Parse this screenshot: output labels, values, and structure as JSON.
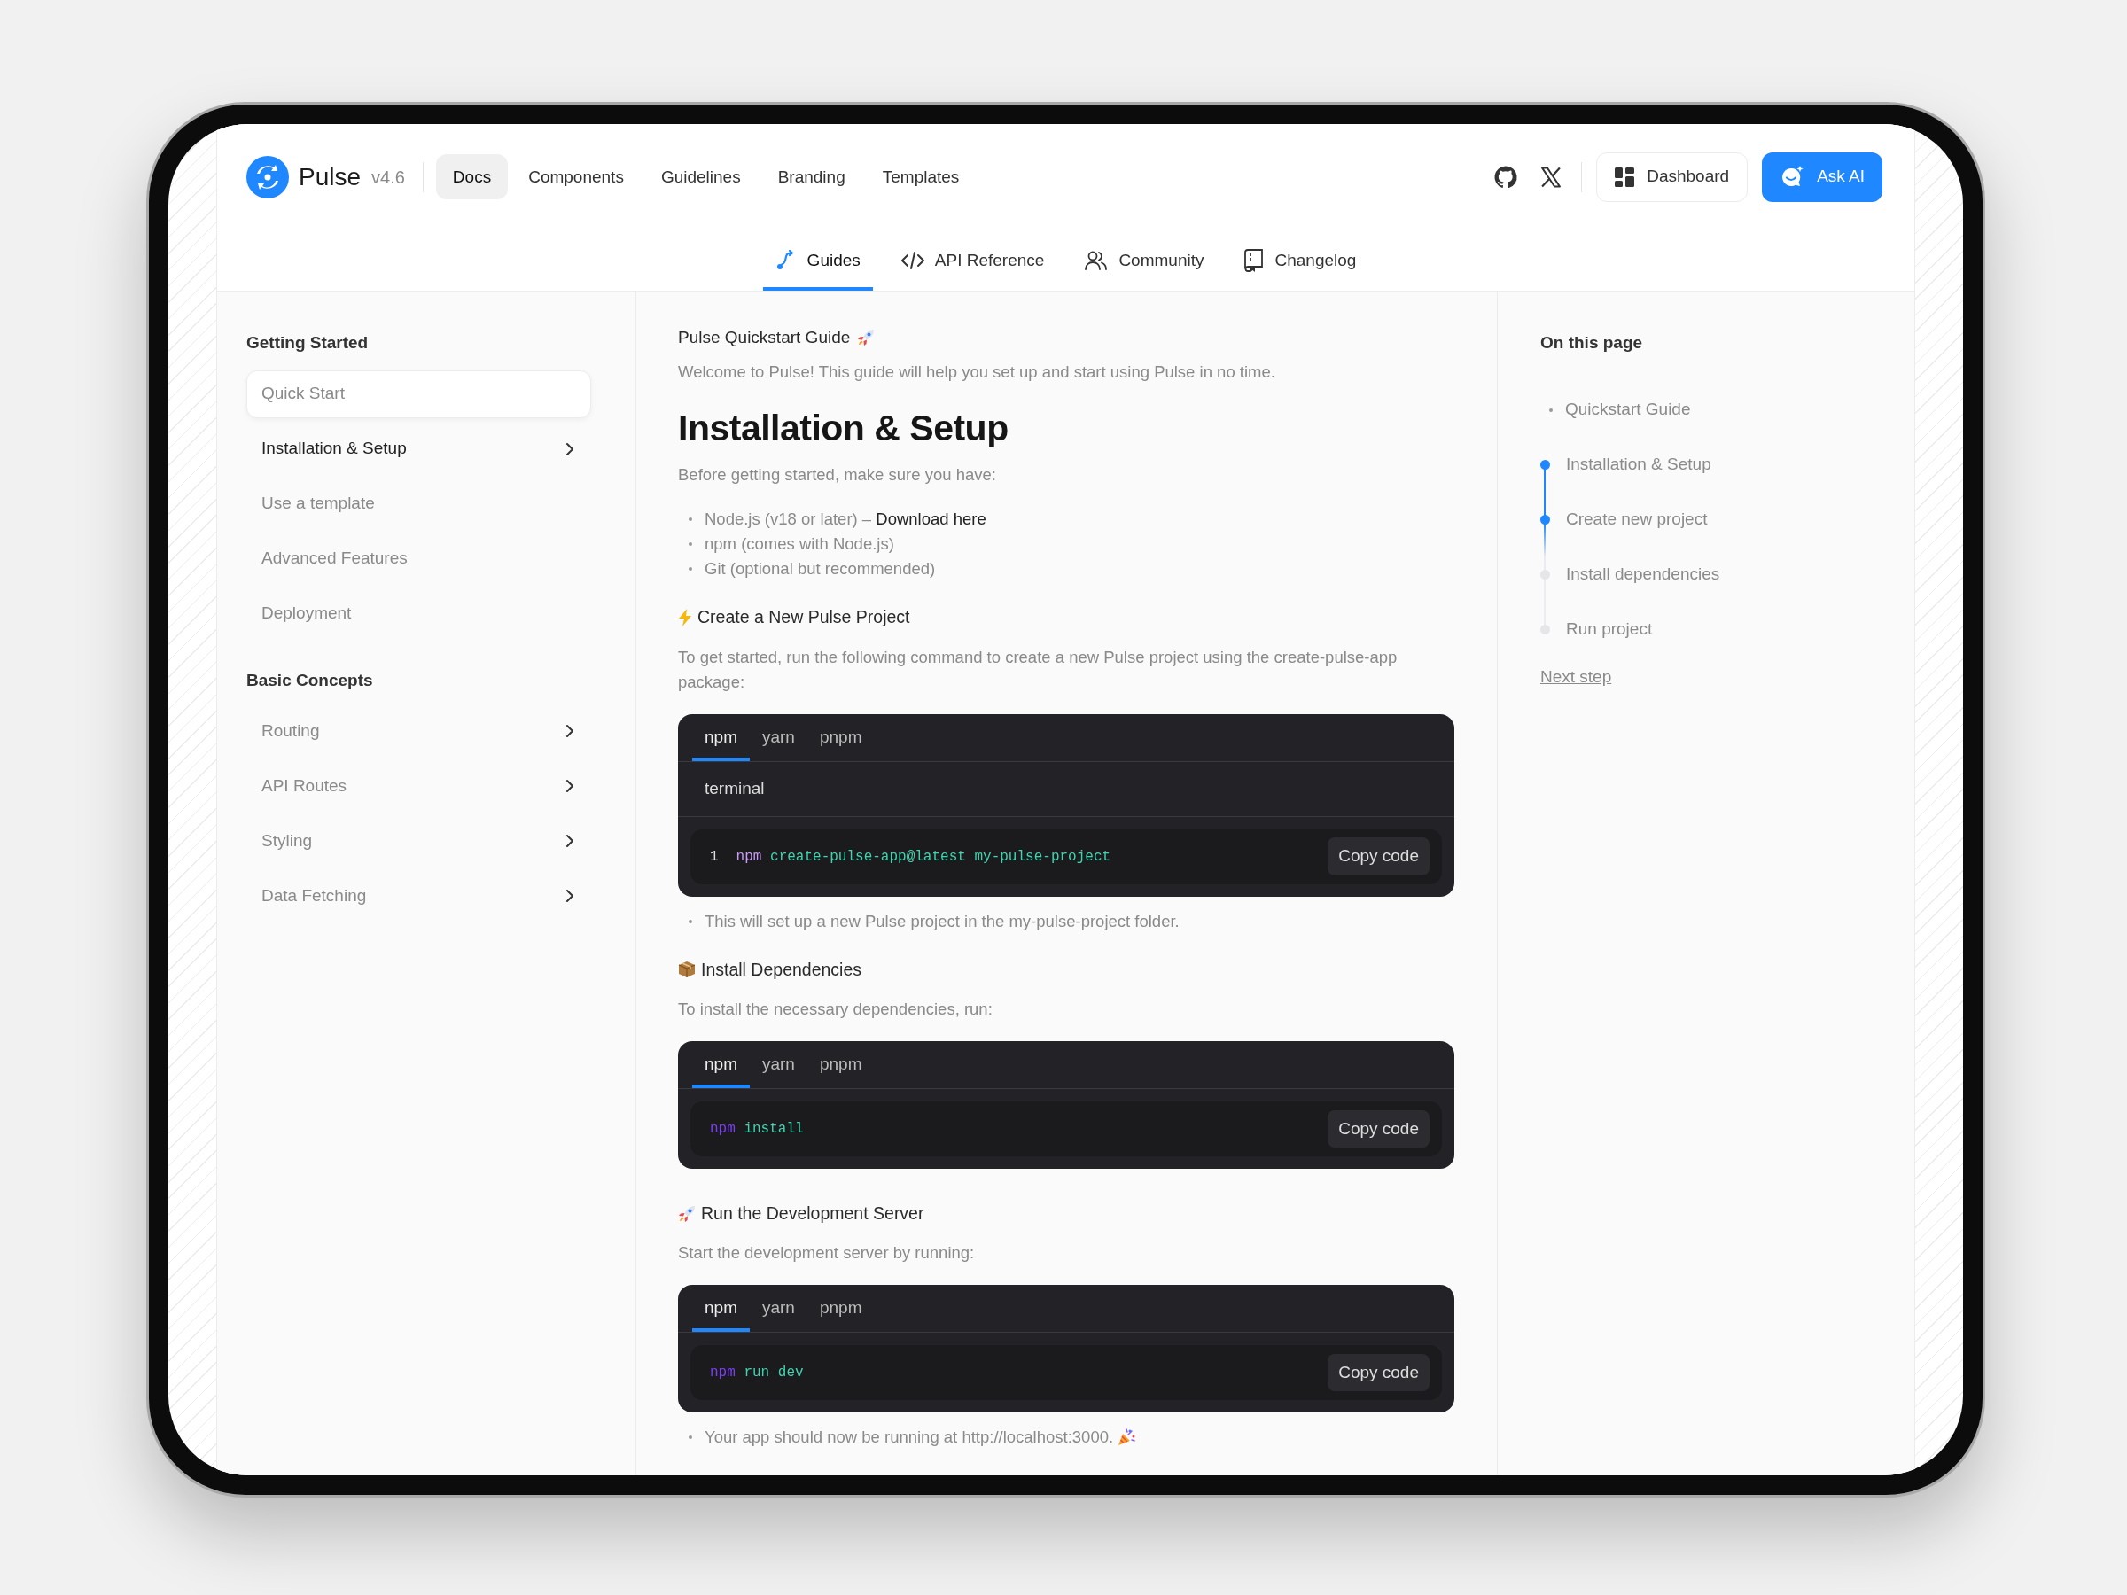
{
  "brand": {
    "name": "Pulse",
    "version": "v4.6"
  },
  "top_nav": [
    {
      "label": "Docs",
      "selected": true
    },
    {
      "label": "Components",
      "selected": false
    },
    {
      "label": "Guidelines",
      "selected": false
    },
    {
      "label": "Branding",
      "selected": false
    },
    {
      "label": "Templates",
      "selected": false
    }
  ],
  "header_buttons": [
    {
      "label": "Dashboard",
      "kind": "outline"
    },
    {
      "label": "Ask AI",
      "kind": "primary"
    }
  ],
  "sub_tabs": [
    {
      "label": "Guides",
      "selected": true
    },
    {
      "label": "API Reference",
      "selected": false
    },
    {
      "label": "Community",
      "selected": false
    },
    {
      "label": "Changelog",
      "selected": false
    }
  ],
  "sidebar": [
    {
      "title": "Getting Started",
      "items": [
        {
          "label": "Quick Start",
          "selected": true,
          "emphasized": false,
          "has_children": false
        },
        {
          "label": "Installation & Setup",
          "selected": false,
          "emphasized": true,
          "has_children": true
        },
        {
          "label": "Use a template",
          "selected": false,
          "emphasized": false,
          "has_children": false
        },
        {
          "label": "Advanced Features",
          "selected": false,
          "emphasized": false,
          "has_children": false
        },
        {
          "label": "Deployment",
          "selected": false,
          "emphasized": false,
          "has_children": false
        }
      ]
    },
    {
      "title": "Basic Concepts",
      "items": [
        {
          "label": "Routing",
          "selected": false,
          "emphasized": false,
          "has_children": true
        },
        {
          "label": "API Routes",
          "selected": false,
          "emphasized": false,
          "has_children": true
        },
        {
          "label": "Styling",
          "selected": false,
          "emphasized": false,
          "has_children": true
        },
        {
          "label": "Data Fetching",
          "selected": false,
          "emphasized": false,
          "has_children": true
        }
      ]
    }
  ],
  "content": [
    {
      "kind": "eyebrow",
      "text": "Pulse Quickstart Guide"
    },
    {
      "kind": "lead",
      "text": "Welcome to Pulse! This guide will help you set up and start using Pulse in no time."
    },
    {
      "kind": "h1",
      "text": "Installation & Setup"
    },
    {
      "kind": "para",
      "text": "Before getting started, make sure you have:"
    },
    {
      "kind": "bullets",
      "items": [
        {
          "text": "Node.js (v18 or later) – ",
          "link": "Download here"
        },
        {
          "text": "npm (comes with Node.js)"
        },
        {
          "text": "Git (optional but recommended)"
        }
      ]
    },
    {
      "kind": "h3",
      "text": "Create a New Pulse Project"
    },
    {
      "kind": "para",
      "text": "To get started, run the following command to create a new Pulse project using the create-pulse-app package:"
    },
    {
      "kind": "code",
      "tabs": [
        {
          "label": "npm",
          "selected": true
        },
        {
          "label": "yarn",
          "selected": false
        },
        {
          "label": "pnpm",
          "selected": false
        }
      ],
      "filename": "terminal",
      "lines": [
        {
          "number": "1",
          "tokens": [
            {
              "text": "npm",
              "color": "#c99cf5"
            },
            {
              "text": "create-pulse-app@latest my-pulse-project",
              "color": "#3fd4b0"
            }
          ]
        }
      ],
      "copy": "Copy code"
    },
    {
      "kind": "bullets",
      "items": [
        {
          "text": "This will set up a new Pulse project in the my-pulse-project folder."
        }
      ]
    },
    {
      "kind": "h3",
      "text": "Install Dependencies"
    },
    {
      "kind": "para",
      "text": "To install the necessary dependencies, run:"
    },
    {
      "kind": "code",
      "tabs": [
        {
          "label": "npm",
          "selected": true
        },
        {
          "label": "yarn",
          "selected": false
        },
        {
          "label": "pnpm",
          "selected": false
        }
      ],
      "lines": [
        {
          "tokens": [
            {
              "text": "npm",
              "color": "#7b3ff2"
            },
            {
              "text": "install",
              "color": "#3fd4b0"
            }
          ]
        }
      ],
      "copy": "Copy code"
    },
    {
      "kind": "h3",
      "text": "Run the Development Server"
    },
    {
      "kind": "para",
      "text": "Start the development server by running:"
    },
    {
      "kind": "code",
      "tabs": [
        {
          "label": "npm",
          "selected": true
        },
        {
          "label": "yarn",
          "selected": false
        },
        {
          "label": "pnpm",
          "selected": false
        }
      ],
      "lines": [
        {
          "tokens": [
            {
              "text": "npm",
              "color": "#7b3ff2"
            },
            {
              "text": "run dev",
              "color": "#3fd4b0"
            }
          ]
        }
      ],
      "copy": "Copy code"
    },
    {
      "kind": "bullets",
      "items": [
        {
          "text": "Your app should now be running at http://localhost:3000.",
          "trailing_icon": true
        }
      ]
    }
  ],
  "toc": {
    "title": "On this page",
    "items": [
      {
        "label": "Quickstart Guide",
        "kind": "bullet"
      },
      {
        "label": "Installation & Setup",
        "kind": "step",
        "active": true
      },
      {
        "label": "Create new project",
        "kind": "step",
        "active": true
      },
      {
        "label": "Install dependencies",
        "kind": "step",
        "active": false
      },
      {
        "label": "Run project",
        "kind": "step",
        "active": false
      }
    ],
    "next": "Next step"
  }
}
